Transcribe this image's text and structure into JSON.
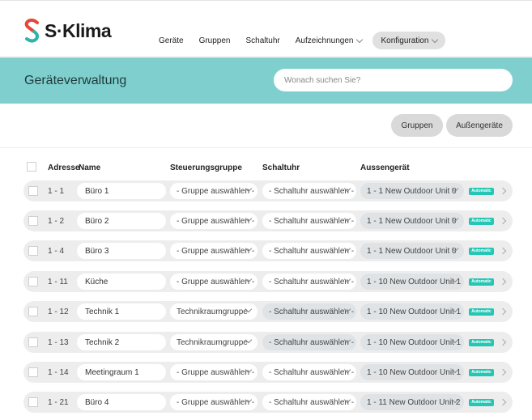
{
  "app": {
    "brand": "S·Klima"
  },
  "nav": [
    {
      "label": "Geräte"
    },
    {
      "label": "Gruppen"
    },
    {
      "label": "Schaltuhr"
    },
    {
      "label": "Aufzeichnungen"
    },
    {
      "label": "Konfiguration"
    }
  ],
  "page": {
    "title": "Geräteverwaltung",
    "search_placeholder": "Wonach suchen Sie?"
  },
  "buttons": {
    "gruppen": "Gruppen",
    "aussengeraete": "Außengeräte"
  },
  "table": {
    "headers": {
      "adresse": "Adresse",
      "name": "Name",
      "steuerungsgruppe": "Steuerungsgruppe",
      "schaltuhr": "Schaltuhr",
      "aussengeraet": "Aussengerät"
    },
    "rows": [
      {
        "adresse": "1 - 1",
        "name": "Büro 1",
        "gruppe": "- Gruppe auswählen -",
        "schaltuhr": "- Schaltuhr auswählen -",
        "aussen": "1 - 1 New Outdoor Unit 0",
        "badge": "Automatic"
      },
      {
        "adresse": "1 - 2",
        "name": "Büro 2",
        "gruppe": "- Gruppe auswählen -",
        "schaltuhr": "- Schaltuhr auswählen -",
        "aussen": "1 - 1 New Outdoor Unit 0",
        "badge": "Automatic"
      },
      {
        "adresse": "1 - 4",
        "name": "Büro 3",
        "gruppe": "- Gruppe auswählen -",
        "schaltuhr": "- Schaltuhr auswählen -",
        "aussen": "1 - 1 New Outdoor Unit 0",
        "badge": "Automatic"
      },
      {
        "adresse": "1 - 11",
        "name": "Küche",
        "gruppe": "- Gruppe auswählen -",
        "schaltuhr": "- Schaltuhr auswählen -",
        "aussen": "1 - 10 New Outdoor Unit 1",
        "badge": "Automatic"
      },
      {
        "adresse": "1 - 12",
        "name": "Technik 1",
        "gruppe": "Technikraumgruppe",
        "schaltuhr": "- Schaltuhr auswählen -",
        "aussen": "1 - 10 New Outdoor Unit 1",
        "badge": "Automatic"
      },
      {
        "adresse": "1 - 13",
        "name": "Technik 2",
        "gruppe": "Technikraumgruppe",
        "schaltuhr": "- Schaltuhr auswählen -",
        "aussen": "1 - 10 New Outdoor Unit 1",
        "badge": "Automatic"
      },
      {
        "adresse": "1 - 14",
        "name": "Meetingraum 1",
        "gruppe": "- Gruppe auswählen -",
        "schaltuhr": "- Schaltuhr auswählen -",
        "aussen": "1 - 10 New Outdoor Unit 1",
        "badge": "Automatic"
      },
      {
        "adresse": "1 - 21",
        "name": "Büro 4",
        "gruppe": "- Gruppe auswählen -",
        "schaltuhr": "- Schaltuhr auswählen -",
        "aussen": "1 - 11 New Outdoor Unit 2",
        "badge": "Automatic"
      }
    ]
  },
  "colors": {
    "brand_teal": "#7fcfcf",
    "logo_red": "#e8443a",
    "logo_teal": "#2bb3ad",
    "badge": "#25c7b4"
  },
  "icons": {
    "logo": "s-klima-logo-icon",
    "dropdown": "chevron-down-icon",
    "row_nav": "chevron-right-icon"
  }
}
